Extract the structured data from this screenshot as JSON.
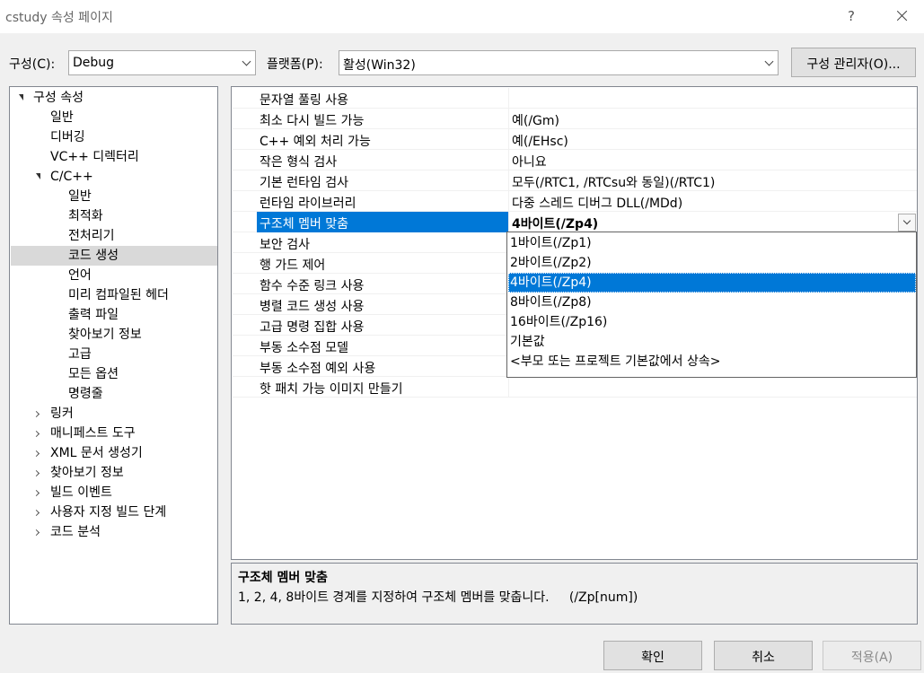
{
  "window": {
    "title": "cstudy 속성 페이지",
    "help": "?"
  },
  "toolbar": {
    "config_label": "구성(C):",
    "config_value": "Debug",
    "platform_label": "플랫폼(P):",
    "platform_value": "활성(Win32)",
    "config_manager_label": "구성 관리자(O)..."
  },
  "tree": {
    "items": [
      {
        "label": "구성 속성"
      },
      {
        "label": "일반"
      },
      {
        "label": "디버깅"
      },
      {
        "label": "VC++ 디렉터리"
      },
      {
        "label": "C/C++"
      },
      {
        "label": "일반"
      },
      {
        "label": "최적화"
      },
      {
        "label": "전처리기"
      },
      {
        "label": "코드 생성"
      },
      {
        "label": "언어"
      },
      {
        "label": "미리 컴파일된 헤더"
      },
      {
        "label": "출력 파일"
      },
      {
        "label": "찾아보기 정보"
      },
      {
        "label": "고급"
      },
      {
        "label": "모든 옵션"
      },
      {
        "label": "명령줄"
      },
      {
        "label": "링커"
      },
      {
        "label": "매니페스트 도구"
      },
      {
        "label": "XML 문서 생성기"
      },
      {
        "label": "찾아보기 정보"
      },
      {
        "label": "빌드 이벤트"
      },
      {
        "label": "사용자 지정 빌드 단계"
      },
      {
        "label": "코드 분석"
      }
    ]
  },
  "grid": {
    "rows": [
      {
        "name": "문자열 풀링 사용",
        "value": ""
      },
      {
        "name": "최소 다시 빌드 가능",
        "value": "예(/Gm)"
      },
      {
        "name": "C++ 예외 처리 가능",
        "value": "예(/EHsc)"
      },
      {
        "name": "작은 형식 검사",
        "value": "아니요"
      },
      {
        "name": "기본 런타임 검사",
        "value": "모두(/RTC1, /RTCsu와 동일)(/RTC1)"
      },
      {
        "name": "런타임 라이브러리",
        "value": "다중 스레드 디버그 DLL(/MDd)"
      },
      {
        "name": "구조체 멤버 맞춤",
        "value": "4바이트(/Zp4)"
      },
      {
        "name": "보안 검사",
        "value": ""
      },
      {
        "name": "행 가드 제어",
        "value": ""
      },
      {
        "name": "함수 수준 링크 사용",
        "value": ""
      },
      {
        "name": "병렬 코드 생성 사용",
        "value": ""
      },
      {
        "name": "고급 명령 집합 사용",
        "value": ""
      },
      {
        "name": "부동 소수점 모델",
        "value": ""
      },
      {
        "name": "부동 소수점 예외 사용",
        "value": ""
      },
      {
        "name": "핫 패치 가능 이미지 만들기",
        "value": ""
      }
    ]
  },
  "dropdown": {
    "options": [
      "1바이트(/Zp1)",
      "2바이트(/Zp2)",
      "4바이트(/Zp4)",
      "8바이트(/Zp8)",
      "16바이트(/Zp16)",
      "기본값",
      "<부모 또는 프로젝트 기본값에서 상속>"
    ]
  },
  "description": {
    "title": "구조체 멤버 맞춤",
    "body": "1, 2, 4, 8바이트 경계를 지정하여 구조체 멤버를 맞춥니다.     (/Zp[num])"
  },
  "buttons": {
    "ok": "확인",
    "cancel": "취소",
    "apply": "적용(A)"
  },
  "colors": {
    "selection": "#0078d7",
    "tree_selection": "#d9d9d9"
  }
}
